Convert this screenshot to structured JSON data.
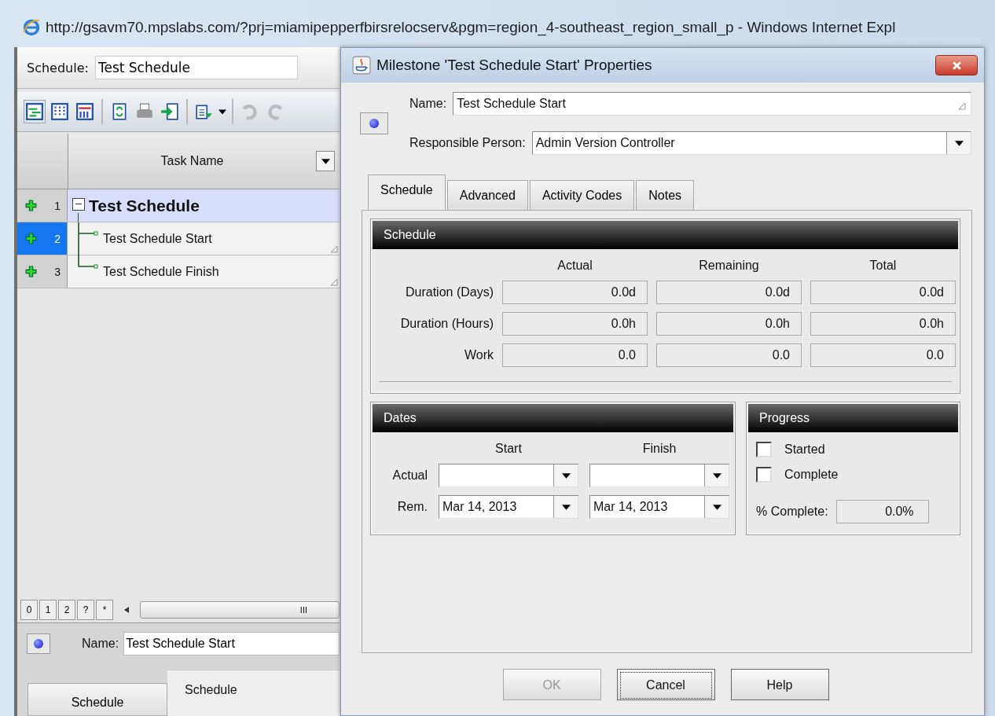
{
  "browser": {
    "title": "http://gsavm70.mpslabs.com/?prj=miamipepperfbirsrelocserv&pgm=region_4-southeast_region_small_p - Windows Internet Expl"
  },
  "schedule_bar": {
    "label": "Schedule:",
    "value": "Test Schedule"
  },
  "task_table": {
    "columns": [
      "Task Name"
    ],
    "rows": [
      {
        "number": "1",
        "name": "Test Schedule",
        "kind": "summary",
        "selected": false,
        "expanded": true,
        "children": [
          {
            "number": "2",
            "name": "Test Schedule Start",
            "kind": "milestone",
            "selected": true
          },
          {
            "number": "3",
            "name": "Test Schedule Finish",
            "kind": "milestone",
            "selected": false
          }
        ]
      }
    ]
  },
  "pager": {
    "buttons": [
      "0",
      "1",
      "2",
      "?",
      "*"
    ],
    "scroll_label": "III"
  },
  "detail": {
    "name_label": "Name:",
    "name_value": "Test Schedule Start",
    "tab": "Schedule",
    "group": "Schedule"
  },
  "dialog": {
    "title": "Milestone 'Test Schedule Start' Properties",
    "name_label": "Name:",
    "name_value": "Test Schedule Start",
    "person_label": "Responsible Person:",
    "person_value": "Admin Version Controller",
    "tabs": [
      {
        "label": "Schedule",
        "selected": true
      },
      {
        "label": "Advanced",
        "selected": false
      },
      {
        "label": "Activity Codes",
        "selected": false
      },
      {
        "label": "Notes",
        "selected": false
      }
    ],
    "schedule": {
      "title": "Schedule",
      "columns": [
        "Actual",
        "Remaining",
        "Total"
      ],
      "rows": [
        {
          "label": "Duration (Days)",
          "values": [
            "0.0d",
            "0.0d",
            "0.0d"
          ]
        },
        {
          "label": "Duration (Hours)",
          "values": [
            "0.0h",
            "0.0h",
            "0.0h"
          ]
        },
        {
          "label": "Work",
          "values": [
            "0.0",
            "0.0",
            "0.0"
          ]
        }
      ]
    },
    "dates": {
      "title": "Dates",
      "columns": [
        "Start",
        "Finish"
      ],
      "rows": [
        {
          "label": "Actual"
        },
        {
          "label": "Rem.",
          "start": "Mar 14, 2013",
          "finish": "Mar 14, 2013"
        }
      ]
    },
    "progress": {
      "title": "Progress",
      "checks": [
        {
          "label": "Started",
          "checked": false
        },
        {
          "label": "Complete",
          "checked": false
        }
      ],
      "percent_label": "% Complete:",
      "percent_value": "0.0%"
    },
    "buttons": [
      {
        "label": "OK",
        "disabled": true,
        "focused": false
      },
      {
        "label": "Cancel",
        "disabled": false,
        "focused": true
      },
      {
        "label": "Help",
        "disabled": false,
        "focused": false
      }
    ]
  }
}
